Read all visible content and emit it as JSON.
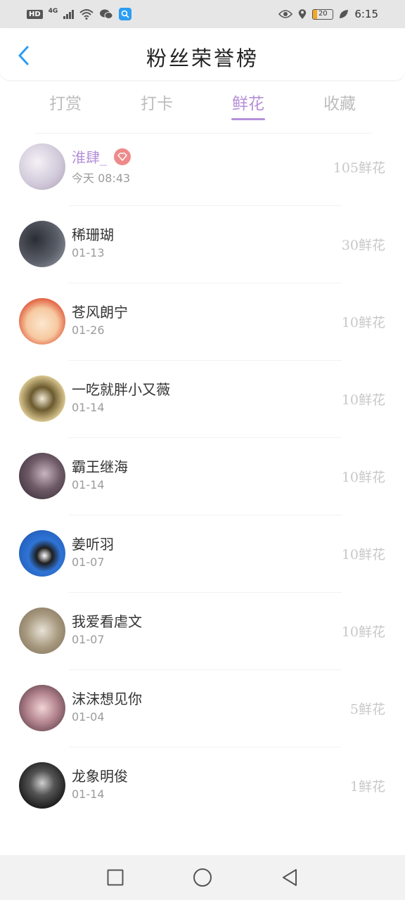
{
  "status_bar": {
    "hd": "HD",
    "network": "4G",
    "battery_level": "20",
    "time": "6:15"
  },
  "header": {
    "title": "粉丝荣誉榜"
  },
  "tabs": [
    {
      "label": "打赏",
      "active": false
    },
    {
      "label": "打卡",
      "active": false
    },
    {
      "label": "鲜花",
      "active": true
    },
    {
      "label": "收藏",
      "active": false
    }
  ],
  "fans": [
    {
      "name": "淮肆_",
      "date": "今天 08:43",
      "amount": "105鲜花",
      "vip": true,
      "avatar_color": "#dcd6e0"
    },
    {
      "name": "稀珊瑚",
      "date": "01-13",
      "amount": "30鲜花",
      "vip": false,
      "avatar_color": "#4b4e56"
    },
    {
      "name": "苍风朗宁",
      "date": "01-26",
      "amount": "10鲜花",
      "vip": false,
      "avatar_color": "#f3e1cc"
    },
    {
      "name": "一吃就胖小又薇",
      "date": "01-14",
      "amount": "10鲜花",
      "vip": false,
      "avatar_color": "#c9b57a"
    },
    {
      "name": "霸王继海",
      "date": "01-14",
      "amount": "10鲜花",
      "vip": false,
      "avatar_color": "#5f4d5a"
    },
    {
      "name": "姜听羽",
      "date": "01-07",
      "amount": "10鲜花",
      "vip": false,
      "avatar_color": "#2e6fc9"
    },
    {
      "name": "我爱看虐文",
      "date": "01-07",
      "amount": "10鲜花",
      "vip": false,
      "avatar_color": "#a99d86"
    },
    {
      "name": "沫沫想见你",
      "date": "01-04",
      "amount": "5鲜花",
      "vip": false,
      "avatar_color": "#b3858f"
    },
    {
      "name": "龙象明俊",
      "date": "01-14",
      "amount": "1鲜花",
      "vip": false,
      "avatar_color": "#262626"
    }
  ],
  "colors": {
    "accent": "#b58fd9",
    "back_arrow": "#2a9df4",
    "badge": "#ef8a8a"
  }
}
